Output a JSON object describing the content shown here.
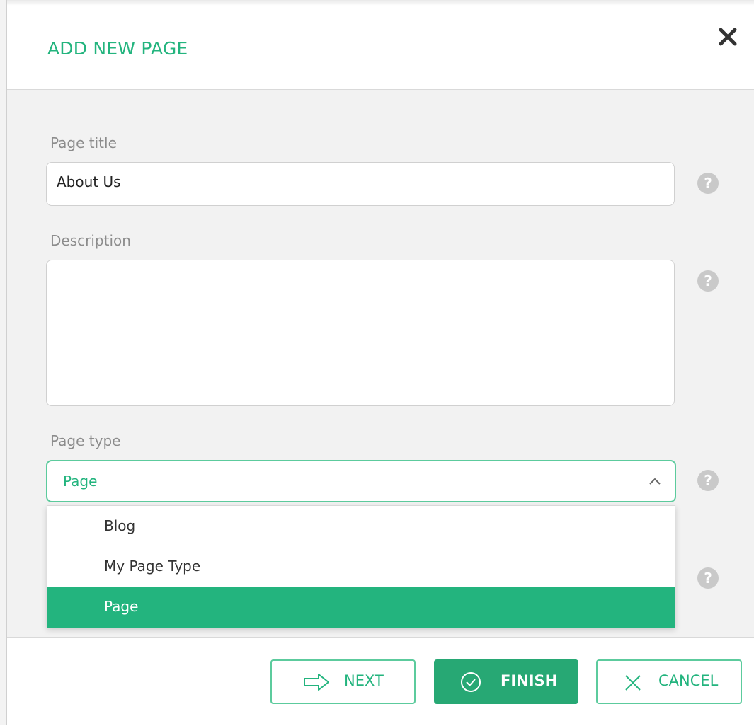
{
  "dialog": {
    "title": "ADD NEW PAGE",
    "close_icon": "close-icon"
  },
  "fields": {
    "page_title": {
      "label": "Page title",
      "value": "About Us"
    },
    "description": {
      "label": "Description",
      "value": ""
    },
    "page_type": {
      "label": "Page type",
      "selected": "Page",
      "options": [
        "Blog",
        "My Page Type",
        "Page"
      ]
    }
  },
  "help_icon_glyph": "?",
  "buttons": {
    "next": "NEXT",
    "finish": "FINISH",
    "cancel": "CANCEL"
  },
  "colors": {
    "accent": "#23b47e",
    "primary_button": "#27a874",
    "help_icon": "#c9c9c9"
  }
}
